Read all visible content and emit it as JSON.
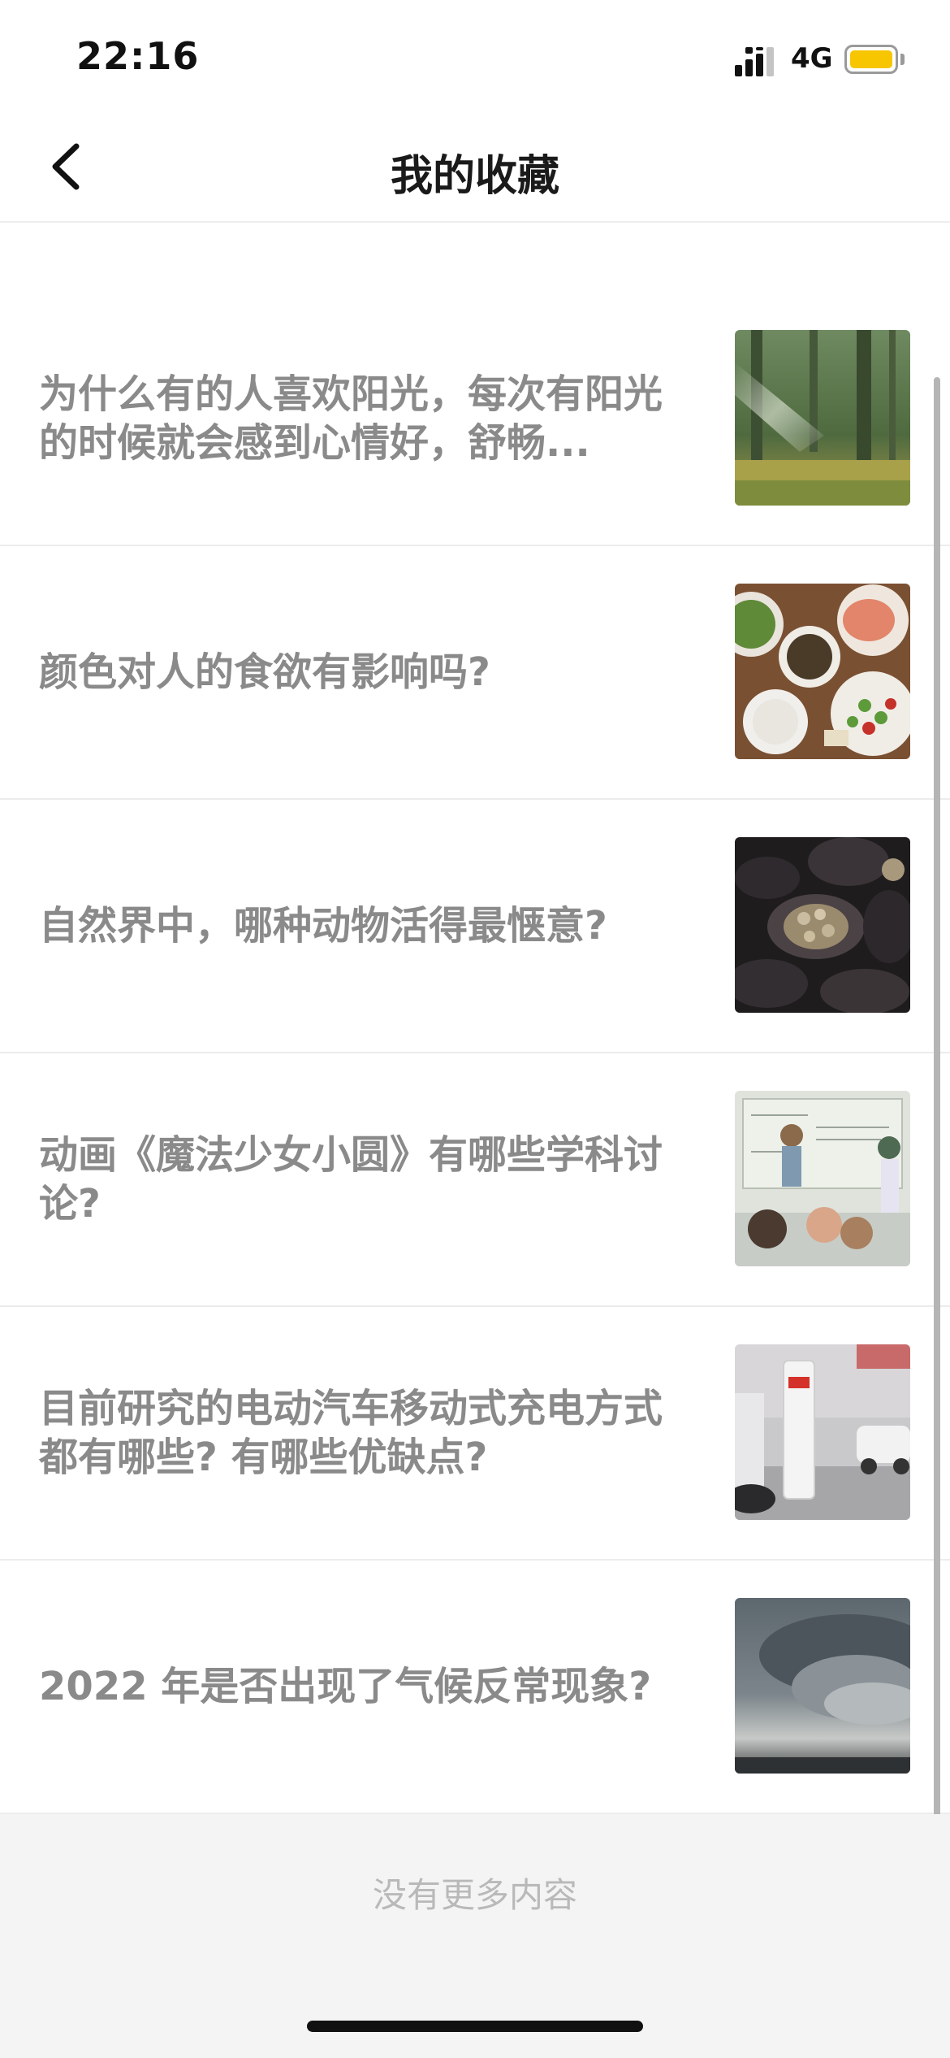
{
  "status_bar": {
    "time": "22:16",
    "network": "4G",
    "battery_color": "#f7c600"
  },
  "nav": {
    "title": "我的收藏",
    "back_icon": "chevron-left-icon"
  },
  "favorites": [
    {
      "title": "为什么有的人喜欢阳光，每次有阳光的时候就会感到心情好，舒畅...",
      "image": "sunlit-forest"
    },
    {
      "title": "颜色对人的食欲有影响吗?",
      "image": "food-platter"
    },
    {
      "title": "自然界中，哪种动物活得最惬意?",
      "image": "mussels-barnacles"
    },
    {
      "title": "动画《魔法少女小圆》有哪些学科讨论?",
      "image": "anime-classroom"
    },
    {
      "title": "目前研究的电动汽车移动式充电方式都有哪些? 有哪些优缺点?",
      "image": "ev-charger"
    },
    {
      "title": "2022 年是否出现了气候反常现象?",
      "image": "storm-cloud"
    }
  ],
  "footer": {
    "text": "没有更多内容"
  }
}
